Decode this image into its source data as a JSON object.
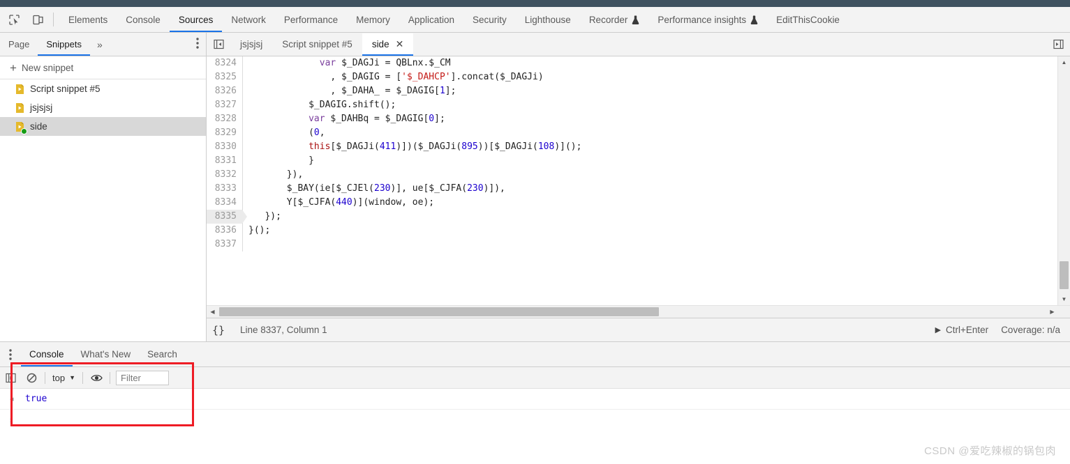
{
  "toolbar": {
    "icons": [
      {
        "name": "inspect-element-icon",
        "glyph": "inspect"
      },
      {
        "name": "device-toolbar-icon",
        "glyph": "device"
      }
    ],
    "tabs": [
      {
        "label": "Elements",
        "active": false,
        "flask": false
      },
      {
        "label": "Console",
        "active": false,
        "flask": false
      },
      {
        "label": "Sources",
        "active": true,
        "flask": false
      },
      {
        "label": "Network",
        "active": false,
        "flask": false
      },
      {
        "label": "Performance",
        "active": false,
        "flask": false
      },
      {
        "label": "Memory",
        "active": false,
        "flask": false
      },
      {
        "label": "Application",
        "active": false,
        "flask": false
      },
      {
        "label": "Security",
        "active": false,
        "flask": false
      },
      {
        "label": "Lighthouse",
        "active": false,
        "flask": false
      },
      {
        "label": "Recorder",
        "active": false,
        "flask": true
      },
      {
        "label": "Performance insights",
        "active": false,
        "flask": true
      },
      {
        "label": "EditThisCookie",
        "active": false,
        "flask": false
      }
    ]
  },
  "navigator": {
    "tabs": [
      {
        "label": "Page",
        "active": false
      },
      {
        "label": "Snippets",
        "active": true
      }
    ],
    "more_label": "»",
    "new_snippet_label": "New snippet",
    "new_snippet_plus": "+",
    "snippets": [
      {
        "label": "Script snippet #5",
        "selected": false,
        "running": false
      },
      {
        "label": "jsjsjsj",
        "selected": false,
        "running": false
      },
      {
        "label": "side",
        "selected": true,
        "running": true
      }
    ]
  },
  "editor": {
    "tabs": [
      {
        "label": "jsjsjsj",
        "active": false,
        "closable": false
      },
      {
        "label": "Script snippet #5",
        "active": false,
        "closable": false
      },
      {
        "label": "side",
        "active": true,
        "closable": true
      }
    ],
    "close_glyph": "✕",
    "first_line_number": 8324,
    "current_line": 8335,
    "lines": [
      {
        "n": 8324,
        "tokens": [
          {
            "t": "var ",
            "c": "kwv"
          },
          {
            "t": "$_DAGJi = QBLnx.$_CM",
            "c": ""
          }
        ]
      },
      {
        "n": 8325,
        "tokens": [
          {
            "t": "  , $_DAGIG = [",
            "c": ""
          },
          {
            "t": "'$_DAHCP'",
            "c": "str"
          },
          {
            "t": "].concat($_DAGJi)",
            "c": ""
          }
        ]
      },
      {
        "n": 8326,
        "tokens": [
          {
            "t": "  , $_DAHA_ = $_DAGIG[",
            "c": ""
          },
          {
            "t": "1",
            "c": "num"
          },
          {
            "t": "];",
            "c": ""
          }
        ]
      },
      {
        "n": 8327,
        "tokens": [
          {
            "t": "$_DAGIG.shift();",
            "c": ""
          }
        ]
      },
      {
        "n": 8328,
        "tokens": [
          {
            "t": "var ",
            "c": "kwv"
          },
          {
            "t": "$_DAHBq = $_DAGIG[",
            "c": ""
          },
          {
            "t": "0",
            "c": "num"
          },
          {
            "t": "];",
            "c": ""
          }
        ]
      },
      {
        "n": 8329,
        "tokens": [
          {
            "t": "(",
            "c": ""
          },
          {
            "t": "0",
            "c": "num"
          },
          {
            "t": ",",
            "c": ""
          }
        ]
      },
      {
        "n": 8330,
        "tokens": [
          {
            "t": "this",
            "c": "thiskw"
          },
          {
            "t": "[$_DAGJi(",
            "c": ""
          },
          {
            "t": "411",
            "c": "num"
          },
          {
            "t": ")])($_DAGJi(",
            "c": ""
          },
          {
            "t": "895",
            "c": "num"
          },
          {
            "t": "))[$_DAGJi(",
            "c": ""
          },
          {
            "t": "108",
            "c": "num"
          },
          {
            "t": ")]();",
            "c": ""
          }
        ]
      },
      {
        "n": 8331,
        "tokens": [
          {
            "t": "  }",
            "c": ""
          }
        ]
      },
      {
        "n": 8332,
        "tokens": [
          {
            "t": "}),",
            "c": ""
          }
        ]
      },
      {
        "n": 8333,
        "tokens": [
          {
            "t": "$_BAY(ie[$_CJEl(",
            "c": ""
          },
          {
            "t": "230",
            "c": "num"
          },
          {
            "t": ")], ue[$_CJFA(",
            "c": ""
          },
          {
            "t": "230",
            "c": "num"
          },
          {
            "t": ")]),",
            "c": ""
          }
        ]
      },
      {
        "n": 8334,
        "tokens": [
          {
            "t": "Y[$_CJFA(",
            "c": ""
          },
          {
            "t": "440",
            "c": "num"
          },
          {
            "t": ")](window, oe);",
            "c": ""
          }
        ]
      },
      {
        "n": 8335,
        "tokens": [
          {
            "t": "});",
            "c": ""
          }
        ]
      },
      {
        "n": 8336,
        "tokens": [
          {
            "t": "}();",
            "c": ""
          }
        ]
      },
      {
        "n": 8337,
        "tokens": [
          {
            "t": "",
            "c": ""
          }
        ]
      }
    ],
    "line_indents": {
      "8324": 13,
      "8325": 13,
      "8326": 13,
      "8327": 11,
      "8328": 11,
      "8329": 11,
      "8330": 11,
      "8331": 9,
      "8332": 7,
      "8333": 7,
      "8334": 7,
      "8335": 3,
      "8336": 0,
      "8337": 0
    },
    "status": {
      "pretty_print_glyph": "{}",
      "position": "Line 8337, Column 1",
      "run_shortcut": "Ctrl+Enter",
      "coverage": "Coverage: n/a"
    }
  },
  "drawer": {
    "tabs": [
      {
        "label": "Console",
        "active": true
      },
      {
        "label": "What's New",
        "active": false
      },
      {
        "label": "Search",
        "active": false
      }
    ],
    "console_toolbar": {
      "sidebar_toggle_name": "console-sidebar-toggle",
      "clear_name": "clear-console-icon",
      "context": "top",
      "context_caret": "▼",
      "eye_name": "console-settings-eye-icon",
      "filter_placeholder": "Filter"
    },
    "messages": [
      {
        "icon": "◂",
        "value": "true",
        "kind": "result"
      }
    ],
    "prompt_caret": "›"
  },
  "annotation": {
    "highlight_color": "#ee1c25"
  },
  "watermark": "CSDN @爱吃辣椒的锅包肉"
}
